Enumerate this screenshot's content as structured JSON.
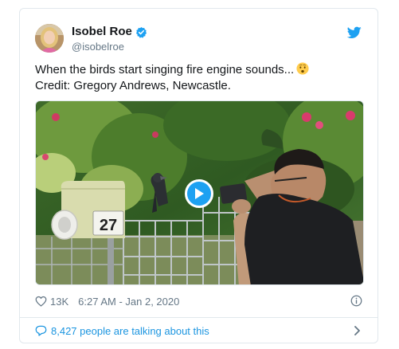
{
  "tweet": {
    "author": {
      "display_name": "Isobel Roe",
      "handle": "@isobelroe",
      "verified": true
    },
    "text_line1": "When the birds start singing fire engine sounds...",
    "text_line2": "Credit: Gregory Andrews, Newcastle.",
    "emoji": "worried-face",
    "media": {
      "type": "video",
      "mailbox_number": "27"
    },
    "likes": "13K",
    "timestamp": "6:27 AM - Jan 2, 2020",
    "conversation_text": "8,427 people are talking about this"
  },
  "colors": {
    "accent": "#1da1f2",
    "link": "#1b95e0",
    "text": "#14171a",
    "secondary_text": "#657786",
    "border": "#e1e8ed"
  },
  "icons": [
    "verified-badge-icon",
    "twitter-bird-icon",
    "heart-icon",
    "info-icon",
    "comment-bubble-icon",
    "chevron-right-icon",
    "play-icon"
  ]
}
